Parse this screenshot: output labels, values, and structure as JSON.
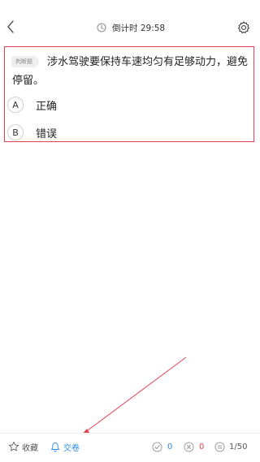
{
  "header": {
    "timer_label": "倒计时 29:58"
  },
  "question": {
    "type_tag": "判断题",
    "text": "涉水驾驶要保持车速均匀有足够动力，避免停留。",
    "options": [
      {
        "letter": "A",
        "text": "正确"
      },
      {
        "letter": "B",
        "text": "错误"
      }
    ]
  },
  "bottom_bar": {
    "favorite_label": "收藏",
    "submit_label": "交卷",
    "correct_count": "0",
    "wrong_count": "0",
    "progress": "1/50"
  },
  "colors": {
    "accent_blue": "#2a8be0",
    "error_red": "#e2404d",
    "highlight_border": "#e2404d",
    "annotation_arrow": "#e2404d"
  },
  "icons": {
    "back": "chevron-left-icon",
    "timer": "clock-icon",
    "settings": "gear-icon",
    "favorite": "star-icon",
    "submit": "bell-icon",
    "correct": "check-circle-icon",
    "wrong": "x-circle-icon",
    "progress": "list-circle-icon"
  }
}
